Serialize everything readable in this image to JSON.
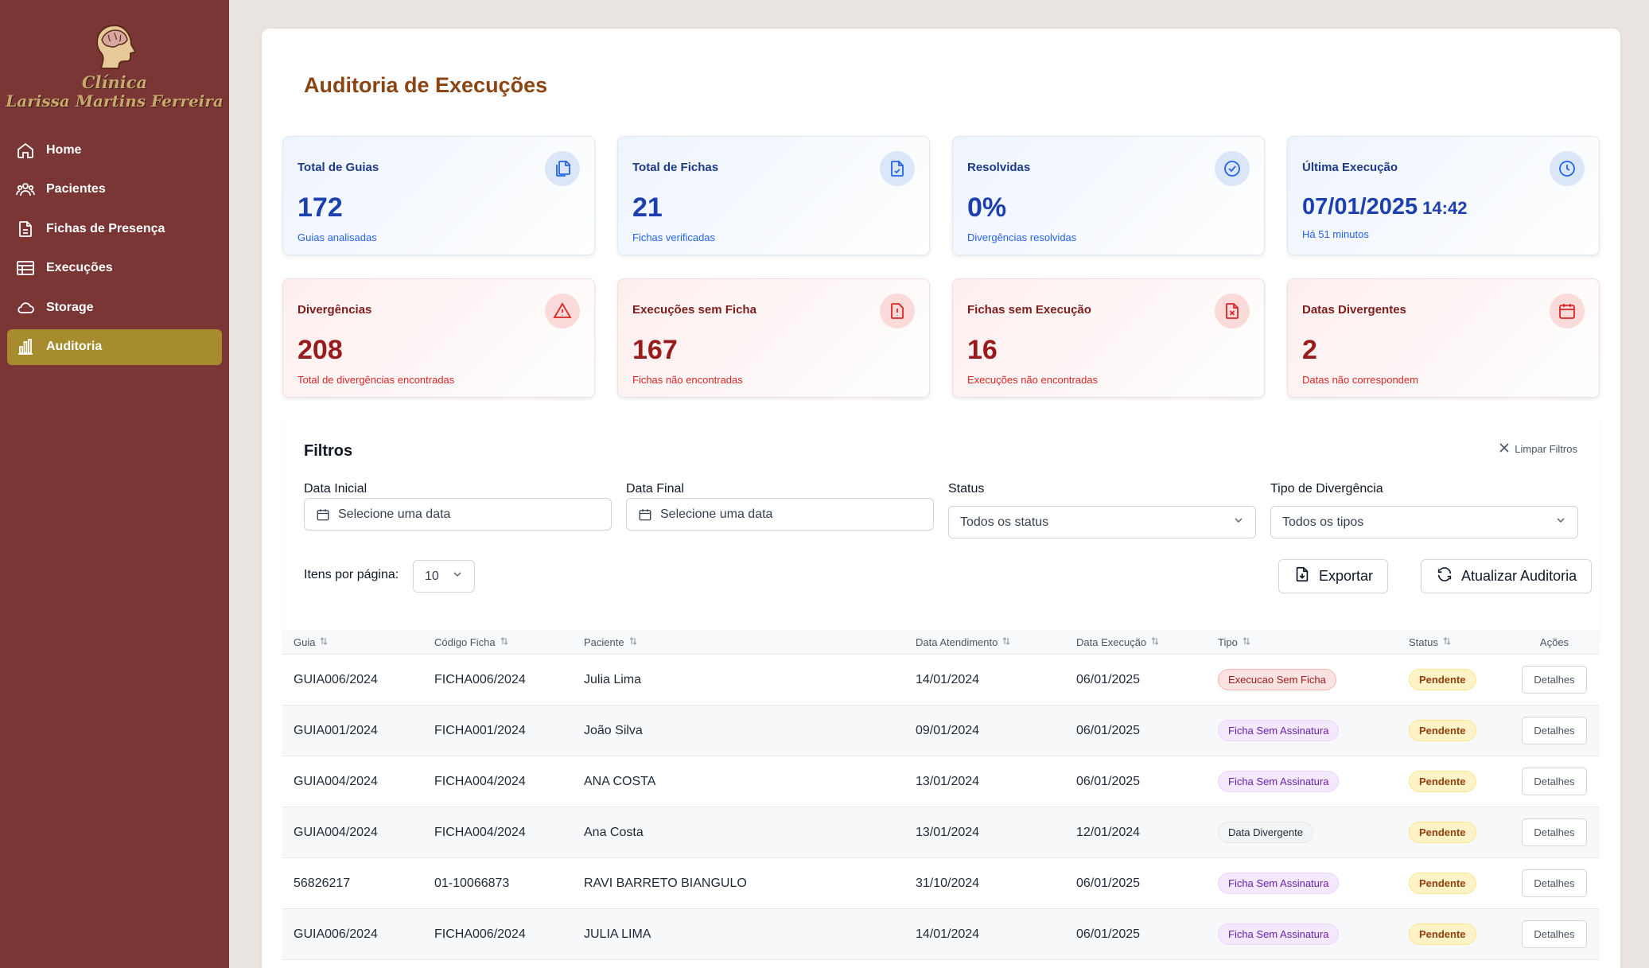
{
  "brand": {
    "line1": "Clínica",
    "line2": "Larissa Martins Ferreira"
  },
  "nav": [
    {
      "label": "Home",
      "icon": "home-icon",
      "active": false
    },
    {
      "label": "Pacientes",
      "icon": "users-icon",
      "active": false
    },
    {
      "label": "Fichas de Presença",
      "icon": "file-icon",
      "active": false
    },
    {
      "label": "Execuções",
      "icon": "table-icon",
      "active": false
    },
    {
      "label": "Storage",
      "icon": "cloud-icon",
      "active": false
    },
    {
      "label": "Auditoria",
      "icon": "bar-chart-icon",
      "active": true
    }
  ],
  "page": {
    "title": "Auditoria de Execuções"
  },
  "stats": {
    "total_guias": {
      "title": "Total de Guias",
      "value": "172",
      "sub": "Guias analisadas",
      "icon": "files-icon"
    },
    "total_fichas": {
      "title": "Total de Fichas",
      "value": "21",
      "sub": "Fichas verificadas",
      "icon": "file-check-icon"
    },
    "resolvidas": {
      "title": "Resolvidas",
      "value": "0%",
      "sub": "Divergências resolvidas",
      "icon": "check-circle-icon"
    },
    "ultima": {
      "title": "Última Execução",
      "date": "07/01/2025",
      "time": "14:42",
      "sub": "Há 51 minutos",
      "icon": "clock-icon"
    },
    "divergencias": {
      "title": "Divergências",
      "value": "208",
      "sub": "Total de divergências encontradas",
      "icon": "alert-triangle-icon"
    },
    "exec_sem_ficha": {
      "title": "Execuções sem Ficha",
      "value": "167",
      "sub": "Fichas não encontradas",
      "icon": "file-alert-icon"
    },
    "fichas_sem_exec": {
      "title": "Fichas sem Execução",
      "value": "16",
      "sub": "Execuções não encontradas",
      "icon": "file-x-icon"
    },
    "datas_div": {
      "title": "Datas Divergentes",
      "value": "2",
      "sub": "Datas não correspondem",
      "icon": "calendar-icon"
    }
  },
  "filters": {
    "title": "Filtros",
    "clear_label": "Limpar Filtros",
    "data_inicial": {
      "label": "Data Inicial",
      "placeholder": "Selecione uma data"
    },
    "data_final": {
      "label": "Data Final",
      "placeholder": "Selecione uma data"
    },
    "status": {
      "label": "Status",
      "value": "Todos os status"
    },
    "tipo": {
      "label": "Tipo de Divergência",
      "value": "Todos os tipos"
    },
    "itens_label": "Itens por página:",
    "itens_value": "10",
    "export_label": "Exportar",
    "refresh_label": "Atualizar Auditoria"
  },
  "table": {
    "headers": [
      "Guia",
      "Código Ficha",
      "Paciente",
      "Data Atendimento",
      "Data Execução",
      "Tipo",
      "Status",
      "Ações"
    ],
    "rows": [
      {
        "guia": "GUIA006/2024",
        "ficha": "FICHA006/2024",
        "paciente": "Julia Lima",
        "atendimento": "14/01/2024",
        "execucao": "06/01/2025",
        "tipo": "Execucao Sem Ficha",
        "tipo_color": "red",
        "status": "Pendente",
        "acao": "Detalhes"
      },
      {
        "guia": "GUIA001/2024",
        "ficha": "FICHA001/2024",
        "paciente": "João Silva",
        "atendimento": "09/01/2024",
        "execucao": "06/01/2025",
        "tipo": "Ficha Sem Assinatura",
        "tipo_color": "purple",
        "status": "Pendente",
        "acao": "Detalhes"
      },
      {
        "guia": "GUIA004/2024",
        "ficha": "FICHA004/2024",
        "paciente": "ANA COSTA",
        "atendimento": "13/01/2024",
        "execucao": "06/01/2025",
        "tipo": "Ficha Sem Assinatura",
        "tipo_color": "purple",
        "status": "Pendente",
        "acao": "Detalhes"
      },
      {
        "guia": "GUIA004/2024",
        "ficha": "FICHA004/2024",
        "paciente": "Ana Costa",
        "atendimento": "13/01/2024",
        "execucao": "12/01/2024",
        "tipo": "Data Divergente",
        "tipo_color": "gray",
        "status": "Pendente",
        "acao": "Detalhes"
      },
      {
        "guia": "56826217",
        "ficha": "01-10066873",
        "paciente": "RAVI BARRETO BIANGULO",
        "atendimento": "31/10/2024",
        "execucao": "06/01/2025",
        "tipo": "Ficha Sem Assinatura",
        "tipo_color": "purple",
        "status": "Pendente",
        "acao": "Detalhes"
      },
      {
        "guia": "GUIA006/2024",
        "ficha": "FICHA006/2024",
        "paciente": "JULIA LIMA",
        "atendimento": "14/01/2024",
        "execucao": "06/01/2025",
        "tipo": "Ficha Sem Assinatura",
        "tipo_color": "purple",
        "status": "Pendente",
        "acao": "Detalhes"
      }
    ]
  },
  "colors": {
    "sidebar": "#7a3535",
    "active_nav": "#a68c2f",
    "title": "#8b4513",
    "stat_blue": "#1e40af",
    "stat_red": "#991b1b"
  }
}
